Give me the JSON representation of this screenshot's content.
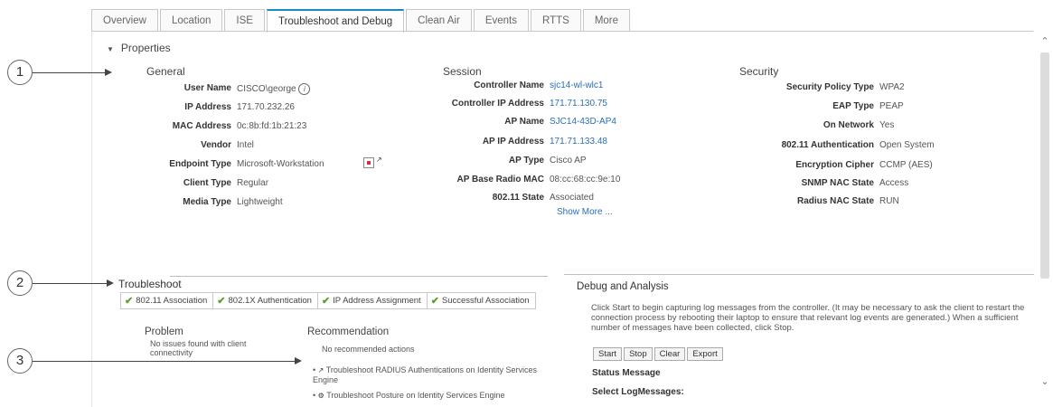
{
  "tabs": [
    {
      "label": "Overview",
      "active": false
    },
    {
      "label": "Location",
      "active": false
    },
    {
      "label": "ISE",
      "active": false
    },
    {
      "label": "Troubleshoot and Debug",
      "active": true
    },
    {
      "label": "Clean Air",
      "active": false
    },
    {
      "label": "Events",
      "active": false
    },
    {
      "label": "RTTS",
      "active": false
    },
    {
      "label": "More",
      "active": false
    }
  ],
  "properties": {
    "title": "Properties",
    "general": {
      "title": "General",
      "rows": [
        {
          "label": "User Name",
          "value": "CISCO\\george"
        },
        {
          "label": "IP Address",
          "value": "171.70.232.26"
        },
        {
          "label": "MAC Address",
          "value": "0c:8b:fd:1b:21:23"
        },
        {
          "label": "Vendor",
          "value": "Intel"
        },
        {
          "label": "Endpoint Type",
          "value": "Microsoft-Workstation"
        },
        {
          "label": "Client Type",
          "value": "Regular"
        },
        {
          "label": "Media Type",
          "value": "Lightweight"
        }
      ]
    },
    "session": {
      "title": "Session",
      "rows": [
        {
          "label": "Controller Name",
          "value": "sjc14-wl-wlc1"
        },
        {
          "label": "Controller IP Address",
          "value": "171.71.130.75"
        },
        {
          "label": "AP Name",
          "value": "SJC14-43D-AP4"
        },
        {
          "label": "AP IP Address",
          "value": "171.71.133.48"
        },
        {
          "label": "AP Type",
          "value": "Cisco AP"
        },
        {
          "label": "AP Base Radio MAC",
          "value": "08:cc:68:cc:9e:10"
        },
        {
          "label": "802.11 State",
          "value": "Associated"
        }
      ],
      "show_more": "Show More ..."
    },
    "security": {
      "title": "Security",
      "rows": [
        {
          "label": "Security Policy Type",
          "value": "WPA2"
        },
        {
          "label": "EAP Type",
          "value": "PEAP"
        },
        {
          "label": "On Network",
          "value": "Yes"
        },
        {
          "label": "802.11 Authentication",
          "value": "Open System"
        },
        {
          "label": "Encryption Cipher",
          "value": "CCMP (AES)"
        },
        {
          "label": "SNMP NAC State",
          "value": "Access"
        },
        {
          "label": "Radius NAC State",
          "value": "RUN"
        }
      ]
    }
  },
  "callouts": [
    "1",
    "2",
    "3"
  ],
  "troubleshoot": {
    "title": "Troubleshoot",
    "steps": [
      "802.11 Association",
      "802.1X Authentication",
      "IP Address Assignment",
      "Successful Association"
    ],
    "problem_title": "Problem",
    "problem_text": "No issues found with client connectivity",
    "recommendation_title": "Recommendation",
    "recommendation_text": "No recommended actions",
    "links": [
      "Troubleshoot RADIUS Authentications on Identity Services Engine",
      "Troubleshoot Posture on Identity Services Engine"
    ]
  },
  "debug": {
    "title": "Debug and Analysis",
    "description": "Click Start to begin capturing log messages from the controller. (It may be necessary to ask the client to restart the connection process by rebooting their laptop to ensure that relevant log events are generated.) When a sufficient number of messages have been collected, click Stop.",
    "buttons": [
      "Start",
      "Stop",
      "Clear",
      "Export"
    ],
    "status_label": "Status Message",
    "select_label": "Select LogMessages:"
  }
}
